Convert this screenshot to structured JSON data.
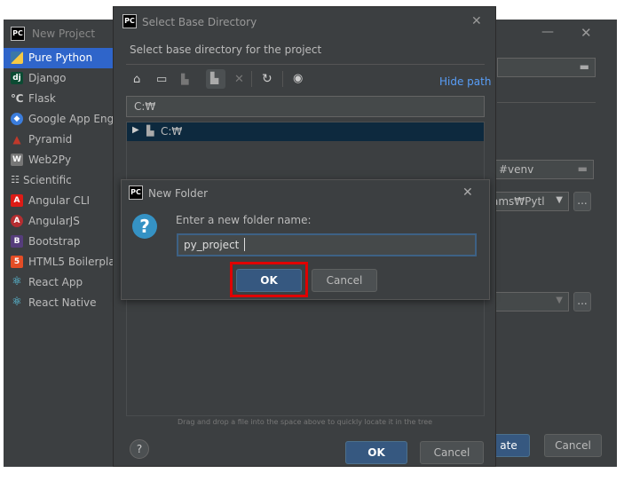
{
  "new_project": {
    "title": "New Project",
    "sidebar": [
      {
        "label": "Pure Python",
        "icon": "python-icon",
        "selected": true
      },
      {
        "label": "Django",
        "icon": "django-icon"
      },
      {
        "label": "Flask",
        "icon": "flask-icon"
      },
      {
        "label": "Google App Engi",
        "icon": "google-app-engine-icon"
      },
      {
        "label": "Pyramid",
        "icon": "pyramid-icon"
      },
      {
        "label": "Web2Py",
        "icon": "web2py-icon"
      },
      {
        "label": "Scientific",
        "icon": "scientific-icon"
      },
      {
        "label": "Angular CLI",
        "icon": "angular-icon"
      },
      {
        "label": "AngularJS",
        "icon": "angularjs-icon"
      },
      {
        "label": "Bootstrap",
        "icon": "bootstrap-icon"
      },
      {
        "label": "HTML5 Boilerplat",
        "icon": "html5-icon"
      },
      {
        "label": "React App",
        "icon": "react-icon"
      },
      {
        "label": "React Native",
        "icon": "react-icon"
      }
    ],
    "venv_value": "#venv",
    "interpreter_value": "ams₩Pytl",
    "create_label": "ate",
    "cancel_label": "Cancel"
  },
  "select_base_dir": {
    "title": "Select Base Directory",
    "description": "Select base directory for the project",
    "hide_path": "Hide path",
    "path_value": "C:₩",
    "tree_root": "C:₩",
    "drag_hint": "Drag and drop a file into the space above to quickly locate it in the tree",
    "ok_label": "OK",
    "cancel_label": "Cancel",
    "help_label": "?"
  },
  "new_folder": {
    "title": "New Folder",
    "prompt": "Enter a new folder name:",
    "input_value": "py_project",
    "ok_label": "OK",
    "cancel_label": "Cancel"
  },
  "logo_text": "PC",
  "colors": {
    "dialog_bg": "#3c3f41",
    "accent": "#2f65ca",
    "primary_button": "#365880",
    "highlight_border": "#e00000",
    "link": "#589df6"
  }
}
